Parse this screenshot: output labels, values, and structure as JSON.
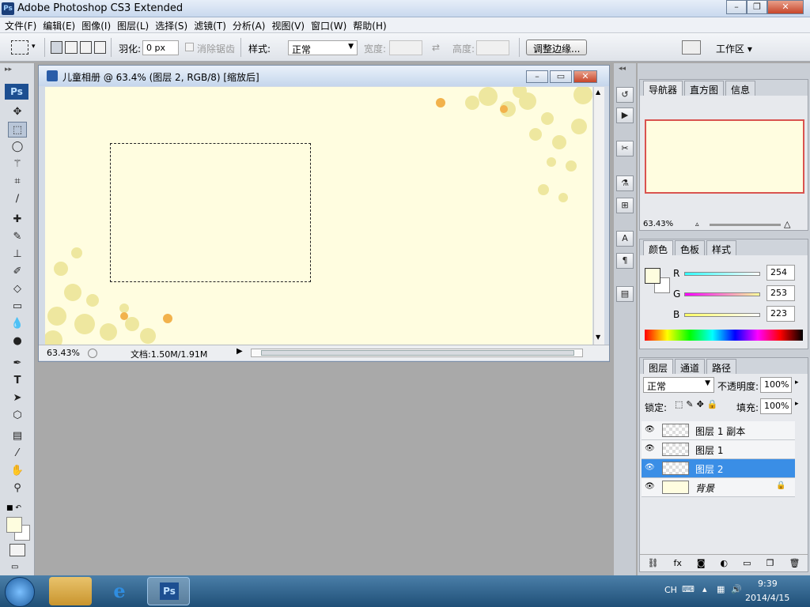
{
  "app": {
    "title": "Adobe Photoshop CS3 Extended",
    "icon_text": "Ps"
  },
  "window_controls": {
    "minimize": "–",
    "restore": "❐",
    "close": "✕"
  },
  "menu": [
    "文件(F)",
    "编辑(E)",
    "图像(I)",
    "图层(L)",
    "选择(S)",
    "滤镜(T)",
    "分析(A)",
    "视图(V)",
    "窗口(W)",
    "帮助(H)"
  ],
  "options": {
    "feather_label": "羽化:",
    "feather_value": "0 px",
    "antialias_label": "消除锯齿",
    "style_label": "样式:",
    "style_value": "正常",
    "width_label": "宽度:",
    "height_label": "高度:",
    "refine_button": "调整边缘...",
    "workspace_label": "工作区 ▾"
  },
  "toolbox": {
    "logo": "Ps"
  },
  "document": {
    "title": "儿童相册 @ 63.4% (图层 2, RGB/8) [缩放后]",
    "zoom": "63.43%",
    "doc_info": "文档:1.50M/1.91M"
  },
  "navigator": {
    "tabs": [
      "导航器",
      "直方图",
      "信息"
    ],
    "zoom": "63.43%"
  },
  "color_panel": {
    "tabs": [
      "颜色",
      "色板",
      "样式"
    ],
    "r_label": "R",
    "r_value": "254",
    "g_label": "G",
    "g_value": "253",
    "b_label": "B",
    "b_value": "223",
    "foreground_color": "#fefddf"
  },
  "layers_panel": {
    "tabs": [
      "图层",
      "通道",
      "路径"
    ],
    "blend_mode": "正常",
    "opacity_label": "不透明度:",
    "opacity_value": "100%",
    "lock_label": "锁定:",
    "fill_label": "填充:",
    "fill_value": "100%",
    "layers": [
      {
        "name": "图层 1 副本"
      },
      {
        "name": "图层 1"
      },
      {
        "name": "图层 2"
      },
      {
        "name": "背景"
      }
    ]
  },
  "taskbar": {
    "lang": "CH",
    "time": "9:39",
    "date": "2014/4/15",
    "ps_label": "Ps"
  },
  "colors": {
    "accent": "#3a8ee6",
    "canvas": "#fffde0"
  }
}
